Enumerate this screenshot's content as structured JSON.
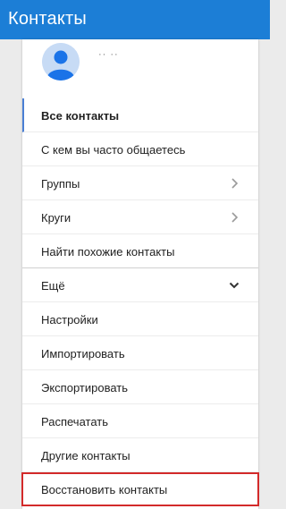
{
  "app": {
    "title": "Контакты"
  },
  "profile": {
    "name": "·· ··"
  },
  "menu": {
    "all_contacts": "Все контакты",
    "frequent": "С кем вы часто общаетесь",
    "groups": "Группы",
    "circles": "Круги",
    "find_duplicates": "Найти похожие контакты",
    "more": "Ещё",
    "settings": "Настройки",
    "import": "Импортировать",
    "export": "Экспортировать",
    "print": "Распечатать",
    "other_contacts": "Другие контакты",
    "restore": "Восстановить контакты"
  },
  "colors": {
    "header": "#1c7ed6",
    "highlight_border": "#d32a2a",
    "active_indicator": "#4a7fd4"
  }
}
